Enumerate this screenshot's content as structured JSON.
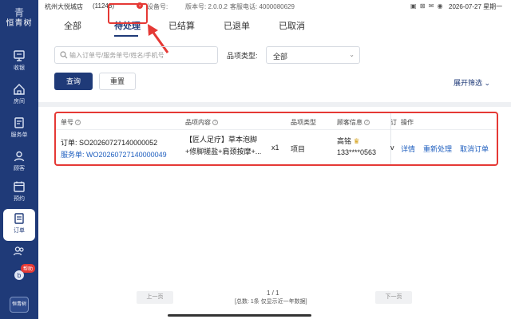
{
  "brand": {
    "logo_text": "恒青树",
    "logo_glyph": "青",
    "bottom_logo": "恒青树"
  },
  "statusbar": {
    "store": "杭州大悦城店",
    "store_code": "(11248)",
    "device_label": "设备号:",
    "version_label": "版本号: 2.0.0.2",
    "phone_label": "客服电话: 4000080629",
    "icons": "▣ ⊠ ✉ ◉",
    "datetime": "2026-07-27 星期一"
  },
  "sidebar": {
    "items": [
      {
        "label": "收银",
        "icon": "cashier-icon"
      },
      {
        "label": "房间",
        "icon": "home-icon"
      },
      {
        "label": "服务单",
        "icon": "service-order-icon"
      },
      {
        "label": "顾客",
        "icon": "customer-icon"
      },
      {
        "label": "预约",
        "icon": "calendar-icon"
      },
      {
        "label": "订单",
        "icon": "order-icon"
      },
      {
        "label": "",
        "icon": "staff-icon"
      },
      {
        "label": "",
        "icon": "help-icon"
      }
    ],
    "help_badge": "帮助",
    "active": "订单"
  },
  "tabs": [
    {
      "label": "全部"
    },
    {
      "label": "待处理",
      "badge": "1"
    },
    {
      "label": "已结算"
    },
    {
      "label": "已退单"
    },
    {
      "label": "已取消"
    }
  ],
  "filters": {
    "search_placeholder": "输入订单号/服务单号/姓名/手机号",
    "type_label": "品项类型:",
    "type_value": "全部",
    "query_button": "查询",
    "reset_button": "重置",
    "expand_filter": "展开筛选"
  },
  "table": {
    "headers": {
      "order_no": "单号",
      "content": "品项内容",
      "type": "品项类型",
      "customer": "顾客信息",
      "hidden": "订",
      "actions": "操作"
    },
    "rows": [
      {
        "order_label": "订单:",
        "order_no": "SO20260727140000052",
        "service_label": "服务单:",
        "service_no": "WO20260727140000049",
        "content_line1": "【匠人足疗】草本泡脚",
        "content_line2": "+修脚搓盐+肩颈按摩+...",
        "qty": "x1",
        "type": "项目",
        "customer_name": "高铭",
        "customer_phone": "133****0563",
        "hidden": "v",
        "actions": [
          "详情",
          "重新处理",
          "取消订单"
        ]
      }
    ]
  },
  "pager": {
    "prev": "上一页",
    "next": "下一页",
    "page": "1 / 1",
    "total": "[总数: 1条 仅显示近一年数据]"
  },
  "colors": {
    "brand": "#1f3a78",
    "highlight": "#e53935",
    "link": "#1f5fbf"
  }
}
